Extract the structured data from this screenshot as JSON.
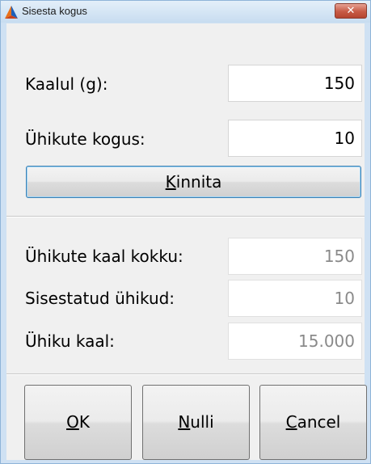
{
  "window": {
    "title": "Sisesta kogus",
    "close_label": "✕",
    "icon": "app-logo-icon"
  },
  "inputs": {
    "weight_label": "Kaalul (g):",
    "weight_value": "150",
    "count_label": "Ühikute kogus:",
    "count_value": "10",
    "confirm_mnemonic": "K",
    "confirm_rest": "innita"
  },
  "results": {
    "total_weight_label": "Ühikute kaal kokku:",
    "total_weight_value": "150",
    "entered_units_label": "Sisestatud ühikud:",
    "entered_units_value": "10",
    "unit_weight_label": "Ühiku kaal:",
    "unit_weight_value": "15.000"
  },
  "buttons": {
    "ok_mnemonic": "O",
    "ok_rest": "K",
    "reset_mnemonic": "N",
    "reset_rest": "ulli",
    "cancel_mnemonic": "C",
    "cancel_rest": "ancel"
  }
}
